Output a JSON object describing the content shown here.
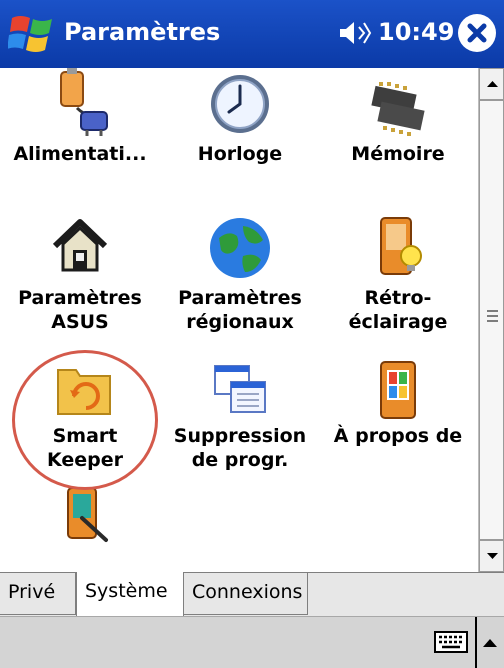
{
  "window": {
    "title": "Paramètres",
    "time": "10:49"
  },
  "icons": {
    "start": "windows-flag-icon",
    "speaker": "speaker-icon",
    "close": "close-icon",
    "keyboard": "keyboard-icon",
    "menu_arrow": "caret-up-icon"
  },
  "items": [
    {
      "label1": "Alimentati...",
      "label2": "",
      "icon": "power-icon"
    },
    {
      "label1": "Horloge",
      "label2": "",
      "icon": "clock-icon"
    },
    {
      "label1": "Mémoire",
      "label2": "",
      "icon": "memory-chip-icon"
    },
    {
      "label1": "Paramètres",
      "label2": "ASUS",
      "icon": "house-icon"
    },
    {
      "label1": "Paramètres",
      "label2": "régionaux",
      "icon": "globe-icon"
    },
    {
      "label1": "Rétro-",
      "label2": "éclairage",
      "icon": "pda-bulb-icon"
    },
    {
      "label1": "Smart",
      "label2": "Keeper",
      "icon": "folder-sync-icon"
    },
    {
      "label1": "Suppression",
      "label2": "de progr.",
      "icon": "window-stack-icon"
    },
    {
      "label1": "À propos de",
      "label2": "",
      "icon": "pda-windows-icon"
    },
    {
      "label1": "",
      "label2": "",
      "icon": "pda-stylus-icon"
    }
  ],
  "tabs": [
    {
      "label": "Privé"
    },
    {
      "label": "Système"
    },
    {
      "label": "Connexions"
    }
  ],
  "colors": {
    "titlebar": "#1b52c8",
    "highlight": "#d45a4b"
  }
}
